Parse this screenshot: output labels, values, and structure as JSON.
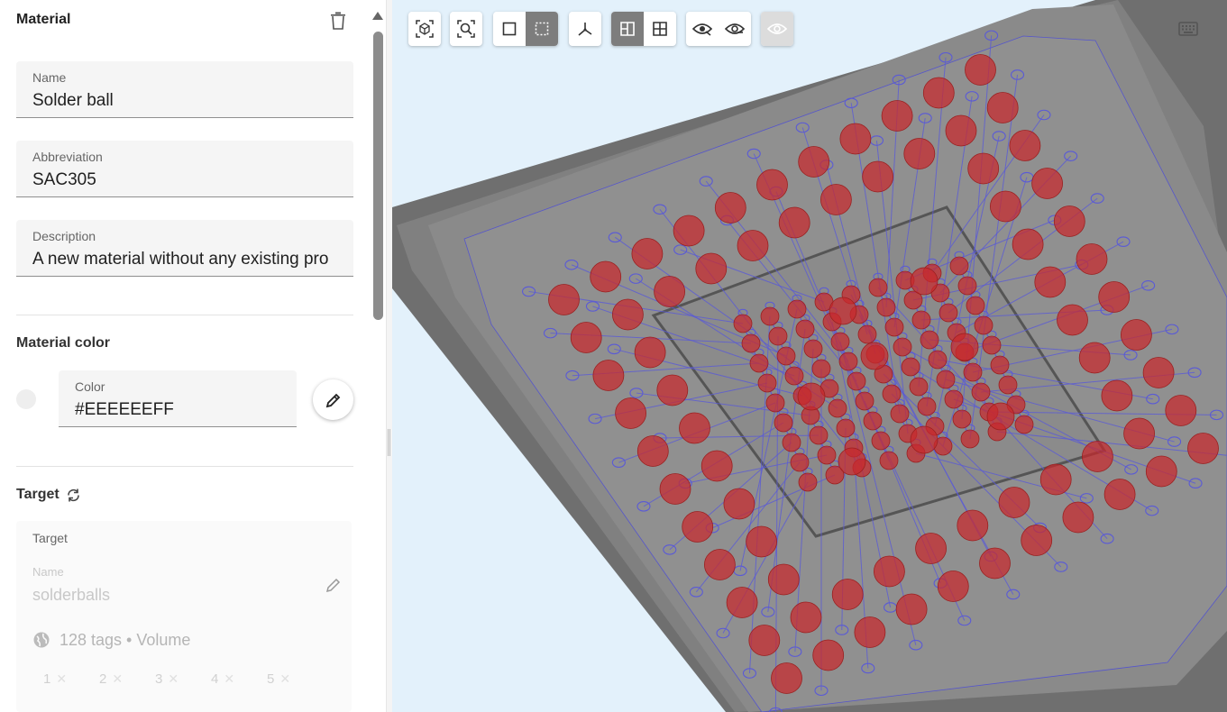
{
  "material": {
    "title": "Material",
    "name_label": "Name",
    "name_value": "Solder ball",
    "abbr_label": "Abbreviation",
    "abbr_value": "SAC305",
    "desc_label": "Description",
    "desc_value": "A new material without any existing pro"
  },
  "material_color": {
    "title": "Material color",
    "color_label": "Color",
    "color_value": "#EEEEEEFF",
    "swatch": "#EEEEEE"
  },
  "target": {
    "title": "Target",
    "box_label": "Target",
    "name_label": "Name",
    "name_value": "solderballs",
    "summary": "128 tags • Volume",
    "tags": [
      "1",
      "2",
      "3",
      "4",
      "5"
    ]
  },
  "toolbar": {
    "icons": [
      "zoom-extents-icon",
      "zoom-box-icon",
      "select-single-icon",
      "select-box-icon",
      "axes-icon",
      "clip-plane-icon",
      "grid-view-icon",
      "hide-icon",
      "show-icon",
      "reset-visibility-icon",
      "keyboard-icon"
    ]
  },
  "colors": {
    "viewport_bg": "#e3f1fb",
    "ball": "#c8282c",
    "trace": "#5a5ad6",
    "package": "#777777"
  }
}
